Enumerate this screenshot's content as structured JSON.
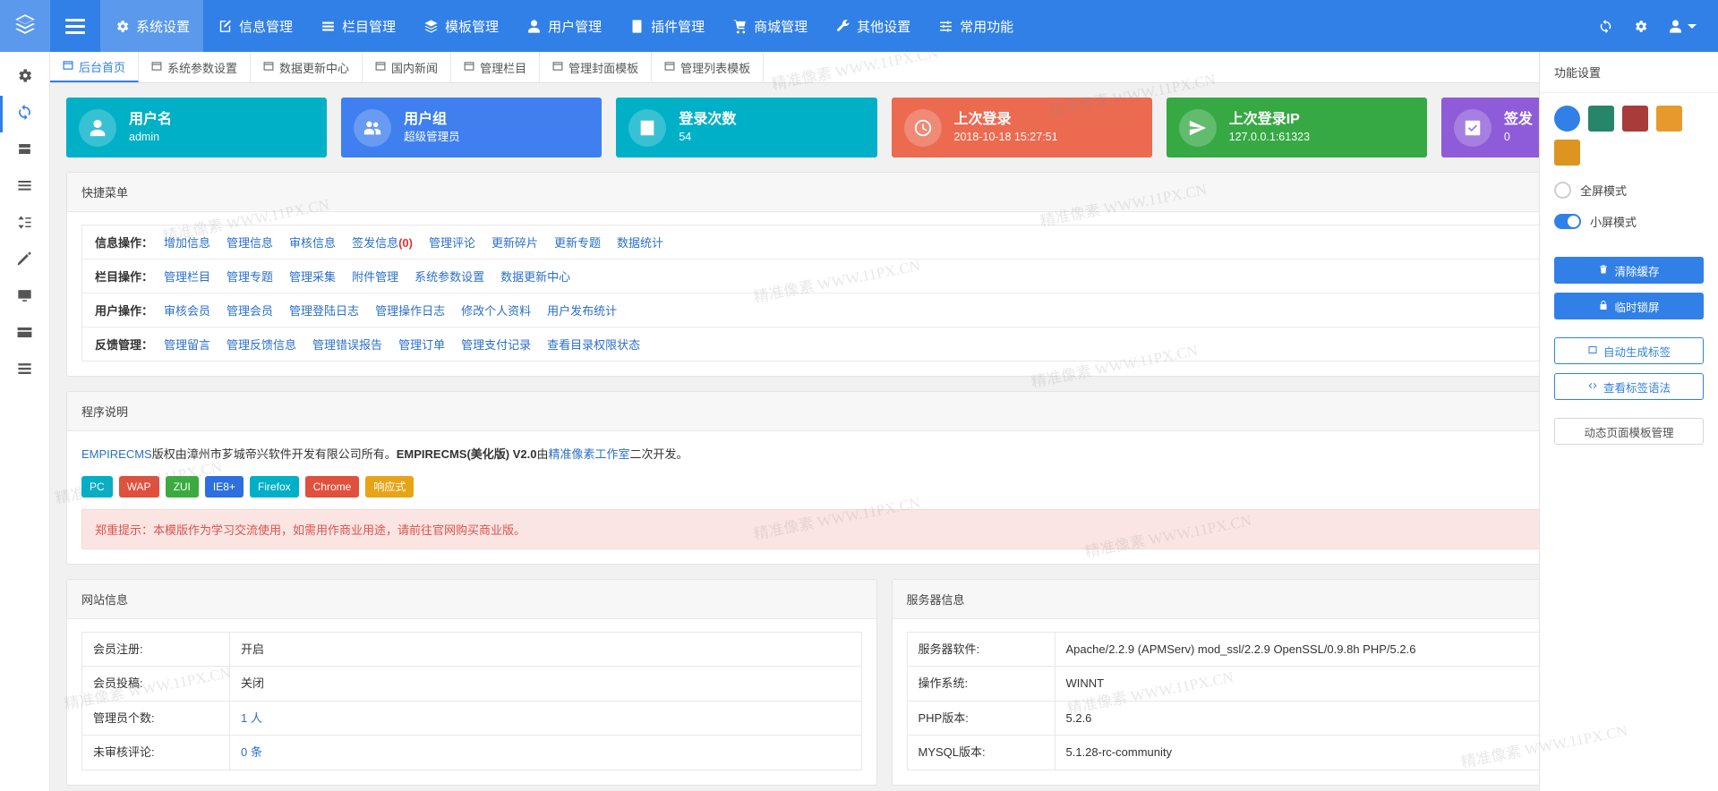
{
  "topbar": {
    "logo_icon": "layers-icon",
    "menu_icon": "hamburger-icon",
    "nav": [
      {
        "label": "系统设置",
        "icon": "gear-icon",
        "active": true
      },
      {
        "label": "信息管理",
        "icon": "edit-note-icon",
        "active": false
      },
      {
        "label": "栏目管理",
        "icon": "list-icon",
        "active": false
      },
      {
        "label": "模板管理",
        "icon": "layers-icon",
        "active": false
      },
      {
        "label": "用户管理",
        "icon": "user-icon",
        "active": false
      },
      {
        "label": "插件管理",
        "icon": "plugin-icon",
        "active": false
      },
      {
        "label": "商城管理",
        "icon": "cart-icon",
        "active": false
      },
      {
        "label": "其他设置",
        "icon": "wrench-icon",
        "active": false
      },
      {
        "label": "常用功能",
        "icon": "sliders-icon",
        "active": false
      }
    ],
    "right_icons": [
      "refresh-icon",
      "gear-icon",
      "user-account-icon"
    ]
  },
  "leftrail": {
    "items": [
      {
        "icon": "gear-icon",
        "active": false
      },
      {
        "icon": "refresh-icon",
        "active": true
      },
      {
        "icon": "database-icon",
        "active": false
      },
      {
        "icon": "list-icon",
        "active": false
      },
      {
        "icon": "sort-icon",
        "active": false
      },
      {
        "icon": "pen-icon",
        "active": false
      },
      {
        "icon": "monitor-icon",
        "active": false
      },
      {
        "icon": "card-icon",
        "active": false
      },
      {
        "icon": "layers-list-icon",
        "active": false
      }
    ]
  },
  "tabs": [
    {
      "label": "后台首页",
      "active": true
    },
    {
      "label": "系统参数设置",
      "active": false
    },
    {
      "label": "数据更新中心",
      "active": false
    },
    {
      "label": "国内新闻",
      "active": false
    },
    {
      "label": "管理栏目",
      "active": false
    },
    {
      "label": "管理封面模板",
      "active": false
    },
    {
      "label": "管理列表模板",
      "active": false
    }
  ],
  "cards": [
    {
      "title": "用户名",
      "value": "admin",
      "color": "#00b0c7",
      "icon": "user-icon"
    },
    {
      "title": "用户组",
      "value": "超级管理员",
      "color": "#3f7ff0",
      "icon": "users-icon"
    },
    {
      "title": "登录次数",
      "value": "54",
      "color": "#00b0c7",
      "icon": "chart-bar-icon"
    },
    {
      "title": "上次登录",
      "value": "2018-10-18 15:27:51",
      "color": "#ec6a50",
      "icon": "clock-icon"
    },
    {
      "title": "上次登录IP",
      "value": "127.0.0.1:61323",
      "color": "#36a944",
      "icon": "send-icon"
    },
    {
      "title": "签发",
      "value": "0",
      "color": "#8e5cd9",
      "icon": "check-square-icon"
    }
  ],
  "quick_menu": {
    "title": "快捷菜单",
    "rows": [
      {
        "label": "信息操作：",
        "links": [
          "增加信息",
          "管理信息",
          "审核信息",
          "签发信息(0)",
          "管理评论",
          "更新碎片",
          "更新专题",
          "数据统计"
        ]
      },
      {
        "label": "栏目操作：",
        "links": [
          "管理栏目",
          "管理专题",
          "管理采集",
          "附件管理",
          "系统参数设置",
          "数据更新中心"
        ]
      },
      {
        "label": "用户操作：",
        "links": [
          "审核会员",
          "管理会员",
          "管理登陆日志",
          "管理操作日志",
          "修改个人资料",
          "用户发布统计"
        ]
      },
      {
        "label": "反馈管理：",
        "links": [
          "管理留言",
          "管理反馈信息",
          "管理错误报告",
          "管理订单",
          "管理支付记录",
          "查看目录权限状态"
        ]
      }
    ]
  },
  "program": {
    "title": "程序说明",
    "line_part1": "EMPIRECMS",
    "line_part2": "版权由漳州市芗城帝兴软件开发有限公司所有。",
    "line_part3": "EMPIRECMS(美化版) V2.0",
    "line_part4": "由",
    "line_part5": "精准像素工作室",
    "line_part6": "二次开发。",
    "tags": [
      {
        "label": "PC",
        "color": "#00b0c7"
      },
      {
        "label": "WAP",
        "color": "#e0503c"
      },
      {
        "label": "ZUI",
        "color": "#3bab3f"
      },
      {
        "label": "IE8+",
        "color": "#2d6fe0"
      },
      {
        "label": "Firefox",
        "color": "#00b0c7"
      },
      {
        "label": "Chrome",
        "color": "#e0503c"
      },
      {
        "label": "响应式",
        "color": "#e8a317"
      }
    ],
    "warning": "郑重提示：本模版作为学习交流使用，如需用作商业用途，请前往官网购买商业版。"
  },
  "site_info": {
    "title": "网站信息",
    "rows": [
      {
        "k": "会员注册:",
        "v": "开启",
        "link": false
      },
      {
        "k": "会员投稿:",
        "v": "关闭",
        "link": false
      },
      {
        "k": "管理员个数:",
        "v": "1 人",
        "link": true
      },
      {
        "k": "未审核评论:",
        "v": "0 条",
        "link": true
      }
    ]
  },
  "server_info": {
    "title": "服务器信息",
    "rows": [
      {
        "k": "服务器软件:",
        "v": "Apache/2.2.9 (APMServ) mod_ssl/2.2.9 OpenSSL/0.9.8h PHP/5.2.6"
      },
      {
        "k": "操作系统:",
        "v": "WINNT"
      },
      {
        "k": "PHP版本:",
        "v": "5.2.6"
      },
      {
        "k": "MYSQL版本:",
        "v": "5.1.28-rc-community"
      }
    ]
  },
  "settings_panel": {
    "title": "功能设置",
    "swatches": [
      "#3180e7",
      "#27856a",
      "#a93b3b",
      "#e79a2b",
      "#dd9420"
    ],
    "selected_swatch_index": 0,
    "options": [
      {
        "label": "全屏模式",
        "on": false
      },
      {
        "label": "小屏模式",
        "on": true
      }
    ],
    "buttons": [
      {
        "label": "清除缓存",
        "style": "blue",
        "icon": "trash-icon"
      },
      {
        "label": "临时锁屏",
        "style": "blue",
        "icon": "lock-icon"
      },
      {
        "label": "自动生成标签",
        "style": "outline",
        "icon": "tag-icon"
      },
      {
        "label": "查看标签语法",
        "style": "outline",
        "icon": "code-icon"
      },
      {
        "label": "动态页面模板管理",
        "style": "gray",
        "icon": "none"
      }
    ]
  },
  "watermarks": [
    "精准像素 WWW.11PX.CN",
    "精准像素 WWW.11PX.CN",
    "精准像素 WWW.11PX.CN",
    "精准像素 WWW.11PX.CN",
    "精准像素 WWW.11PX.CN",
    "精准像素 WWW.11PX.CN",
    "精准像素 WWW.11PX.CN",
    "精准像素 WWW.11PX.CN",
    "精准像素 WWW.11PX.CN",
    "精准像素 WWW.11PX.CN",
    "精准像素 WWW.11PX.CN",
    "精准像素 WWW.11PX.CN"
  ]
}
